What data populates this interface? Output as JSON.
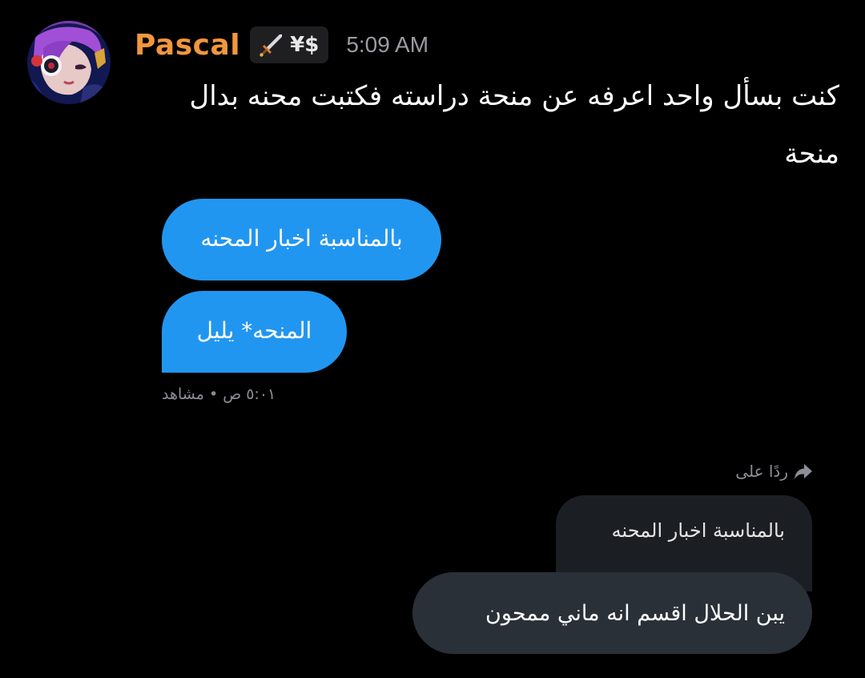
{
  "post": {
    "username": "Pascal",
    "tag_icon": "sword-icon",
    "tag_text": "¥$",
    "timestamp": "5:09 AM",
    "text": "كنت بسأل واحد اعرفه عن منحة دراسته فكتبت محنه بدال منحة",
    "username_color": "#f0973c"
  },
  "chat": {
    "sent_messages": [
      "بالمناسبة اخبار المحنه",
      "المنحه* يليل"
    ],
    "seen_status": "٥:٠١ ص • مشاهد",
    "reply_label": "ردًا على",
    "reply_icon": "reply-arrow-icon",
    "quoted_message": "بالمناسبة اخبار المحنه",
    "reply_message": "يبن الحلال اقسم انه ماني ممحون",
    "sent_bubble_color": "#2196f0",
    "received_bubble_color": "#2a3038"
  }
}
